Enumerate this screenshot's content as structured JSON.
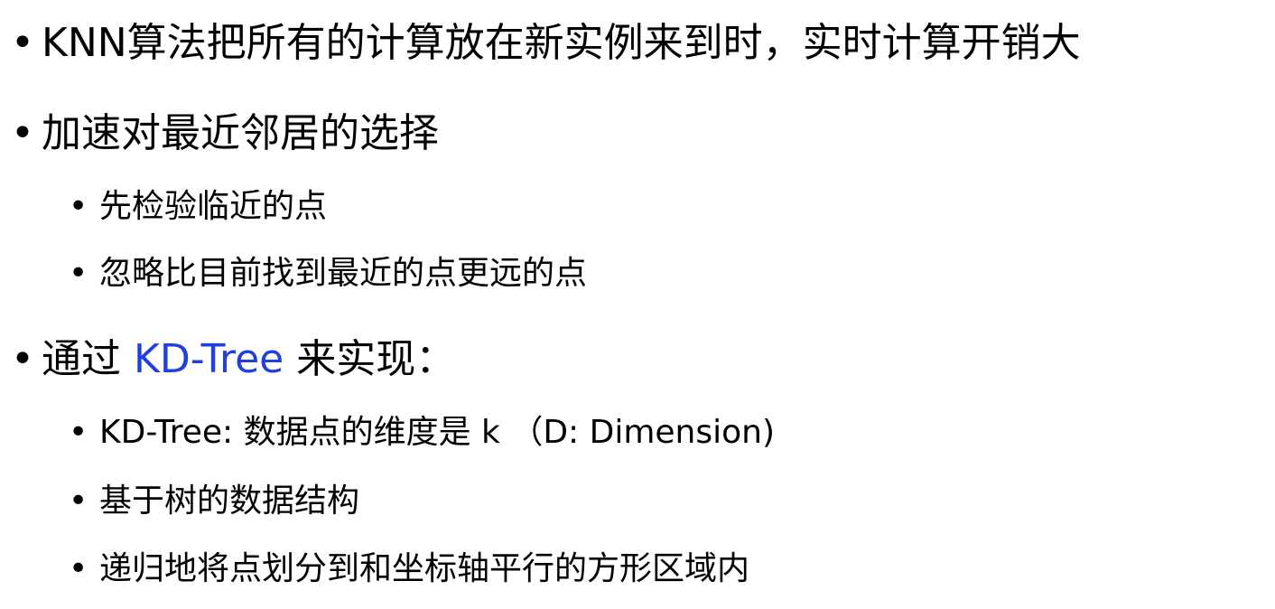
{
  "bullet_glyph": "•",
  "items": {
    "b1": {
      "text": "KNN算法把所有的计算放在新实例来到时，实时计算开销大"
    },
    "b2": {
      "text": "加速对最近邻居的选择",
      "children": [
        "先检验临近的点",
        "忽略比目前找到最近的点更远的点"
      ]
    },
    "b3": {
      "prefix": "通过 ",
      "highlight": "KD-Tree",
      "suffix": " 来实现：",
      "children": [
        "KD-Tree: 数据点的维度是 k （D: Dimension)",
        "基于树的数据结构",
        "递归地将点划分到和坐标轴平行的方形区域内"
      ]
    }
  },
  "colors": {
    "text": "#000000",
    "accent": "#1f3fe0",
    "background": "#ffffff"
  }
}
